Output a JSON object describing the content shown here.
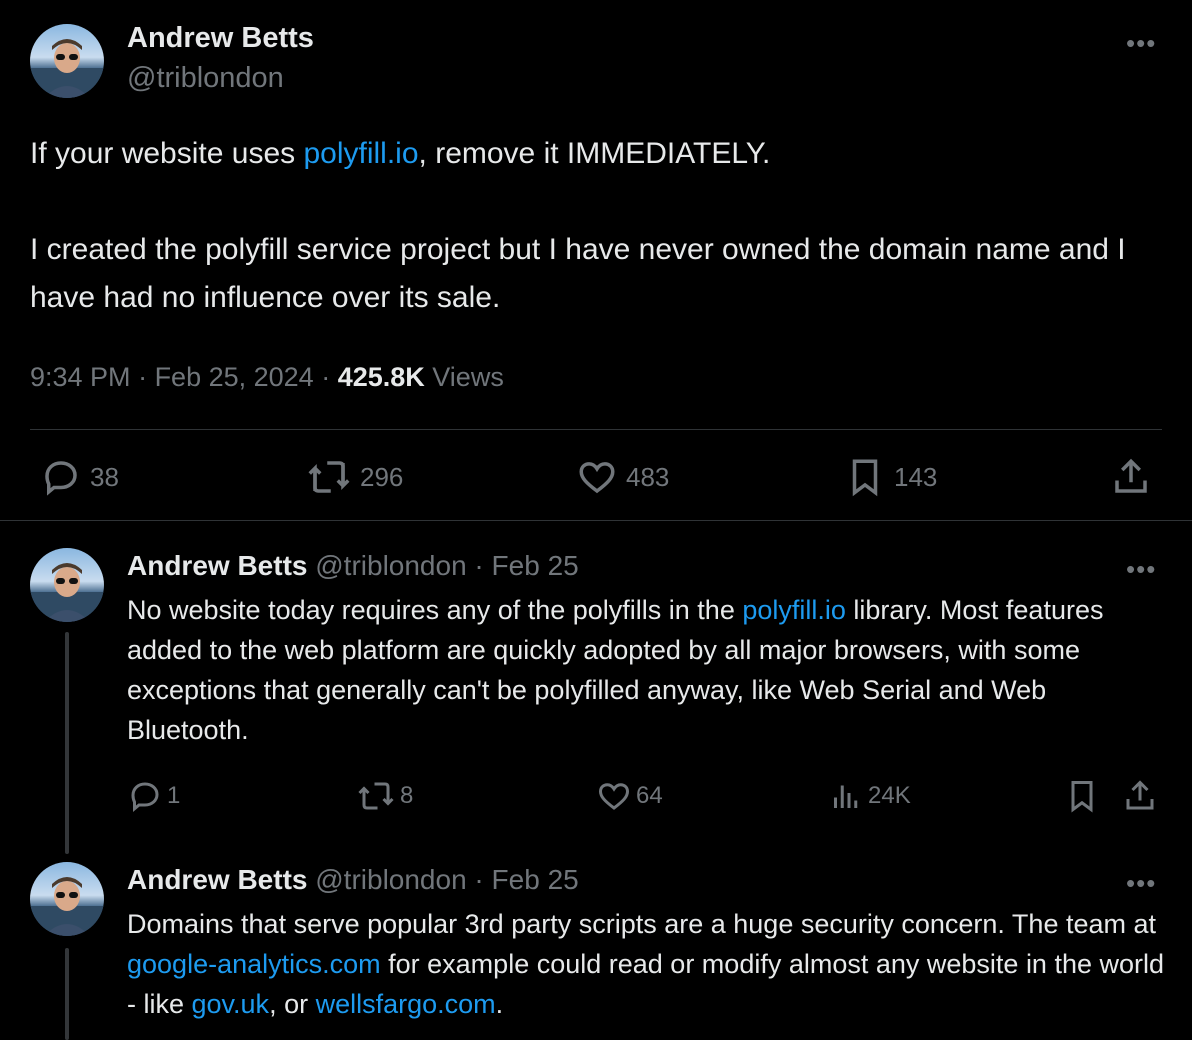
{
  "main_tweet": {
    "author_name": "Andrew Betts",
    "author_handle": "@triblondon",
    "more_glyph": "•••",
    "text_p1_before": "If your website uses ",
    "text_p1_link": "polyfill.io",
    "text_p1_after": ", remove it IMMEDIATELY.",
    "text_p2": "I created the polyfill service project but I have never owned the domain name and I have had no influence over its sale.",
    "time": "9:34 PM",
    "sep1": " · ",
    "date": "Feb 25, 2024",
    "sep2": " · ",
    "views_count": "425.8K",
    "views_label": " Views",
    "actions": {
      "replies": "38",
      "reposts": "296",
      "likes": "483",
      "bookmarks": "143"
    }
  },
  "replies": [
    {
      "author_name": "Andrew Betts",
      "author_handle": "@triblondon",
      "dot": " · ",
      "date": "Feb 25",
      "more_glyph": "•••",
      "text_before": "No website today requires any of the polyfills in the ",
      "text_link": "polyfill.io",
      "text_after": " library. Most features added to the web platform are quickly adopted by all major browsers, with some exceptions that generally can't be polyfilled anyway, like Web Serial and Web Bluetooth.",
      "actions": {
        "replies": "1",
        "reposts": "8",
        "likes": "64",
        "views": "24K"
      }
    },
    {
      "author_name": "Andrew Betts",
      "author_handle": "@triblondon",
      "dot": " · ",
      "date": "Feb 25",
      "more_glyph": "•••",
      "text_a": "Domains that serve popular 3rd party scripts are a huge security concern. The team at ",
      "link_1": "google-analytics.com",
      "text_b": " for example could read or modify almost any website in the world - like ",
      "link_2": "gov.uk",
      "text_c": ", or ",
      "link_3": "wellsfargo.com",
      "text_d": "."
    }
  ],
  "colors": {
    "background": "#000000",
    "text": "#e7e9ea",
    "muted": "#71767b",
    "link": "#1d9bf0",
    "divider": "#2f3336"
  }
}
